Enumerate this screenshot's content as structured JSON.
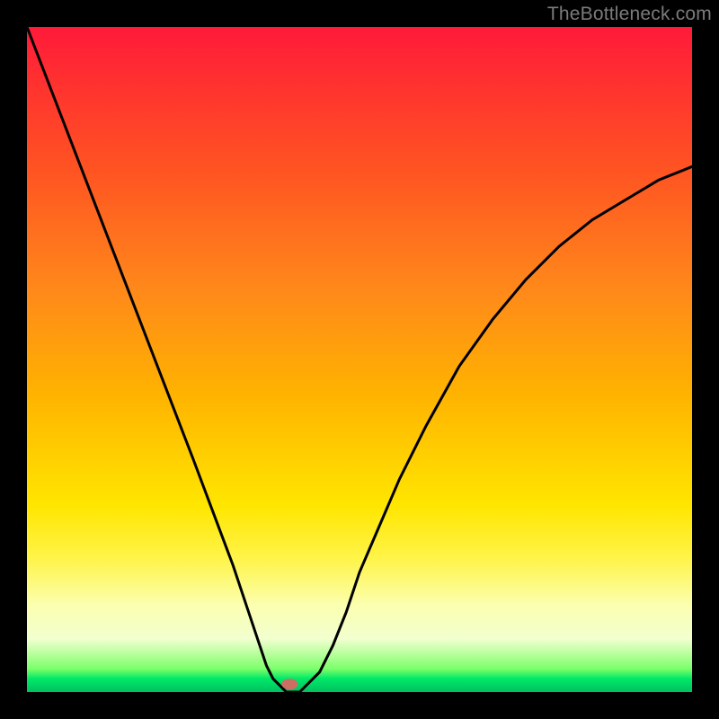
{
  "watermark": "TheBottleneck.com",
  "chart_data": {
    "type": "line",
    "title": "",
    "xlabel": "",
    "ylabel": "",
    "xlim": [
      0,
      100
    ],
    "ylim": [
      0,
      100
    ],
    "series": [
      {
        "name": "bottleneck-curve",
        "x": [
          0,
          5,
          10,
          15,
          20,
          25,
          28,
          31,
          33,
          35,
          36,
          37,
          38,
          39,
          40,
          41,
          42,
          44,
          46,
          48,
          50,
          53,
          56,
          60,
          65,
          70,
          75,
          80,
          85,
          90,
          95,
          100
        ],
        "values": [
          100,
          87,
          74,
          61,
          48,
          35,
          27,
          19,
          13,
          7,
          4,
          2,
          1,
          0,
          0,
          0,
          1,
          3,
          7,
          12,
          18,
          25,
          32,
          40,
          49,
          56,
          62,
          67,
          71,
          74,
          77,
          79
        ]
      }
    ],
    "annotations": [
      {
        "name": "min-marker",
        "x": 39.5,
        "y": 1.2,
        "color": "#cc6f63"
      }
    ],
    "background_gradient": {
      "top": "#ff1a3a",
      "mid": "#ffe600",
      "bottom": "#00c060"
    }
  }
}
